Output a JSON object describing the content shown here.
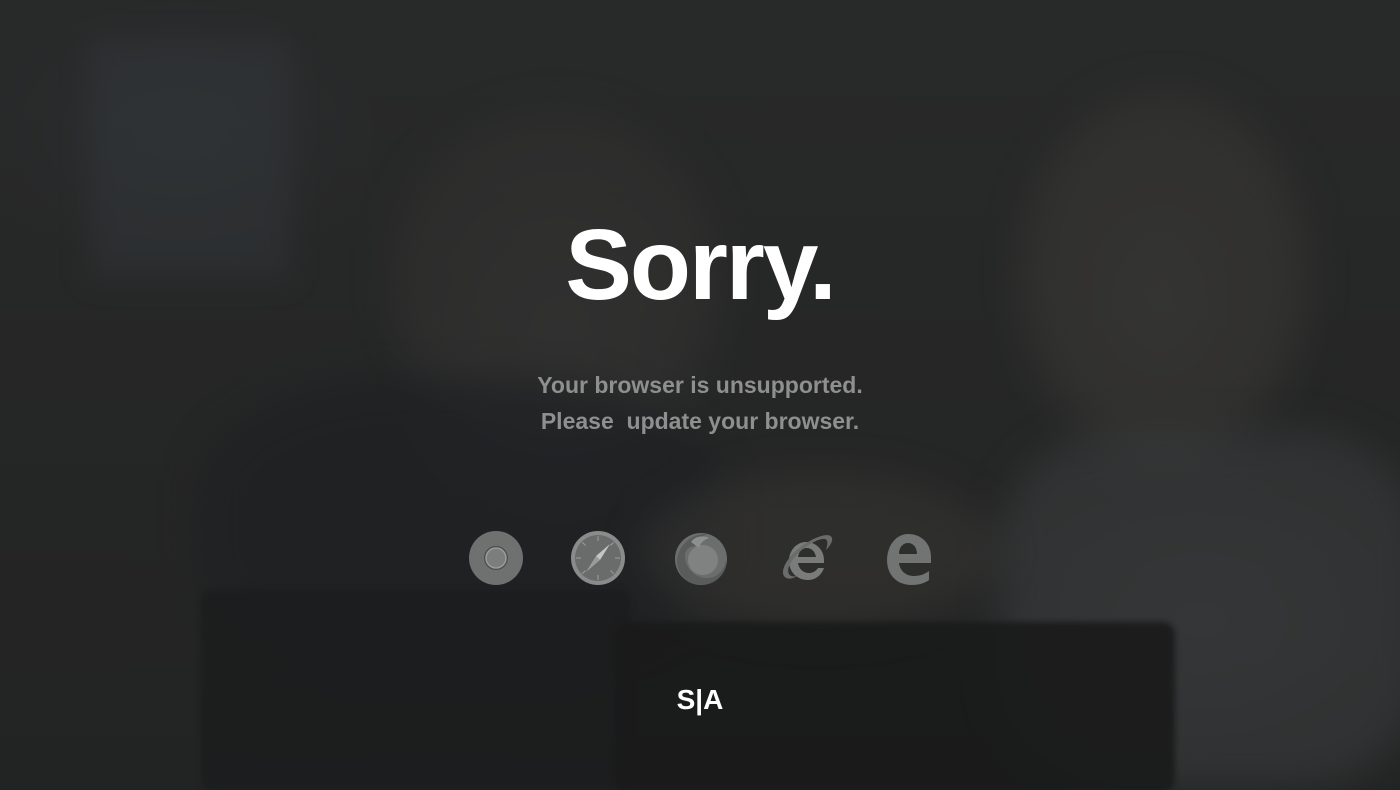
{
  "page": {
    "title": "Sorry.",
    "message_line1": "Your browser is unsupported.",
    "message_line2": "Please  update your browser."
  },
  "browsers": [
    {
      "name": "Chrome",
      "icon": "chrome-icon"
    },
    {
      "name": "Safari",
      "icon": "safari-icon"
    },
    {
      "name": "Firefox",
      "icon": "firefox-icon"
    },
    {
      "name": "Internet Explorer",
      "icon": "internet-explorer-icon"
    },
    {
      "name": "Edge",
      "icon": "edge-icon"
    }
  ],
  "footer": {
    "logo_text": "S|A"
  },
  "colors": {
    "background": "#2b2c2c",
    "title": "#ffffff",
    "message": "#8e8f8f",
    "icon": "#7a7b7b"
  }
}
